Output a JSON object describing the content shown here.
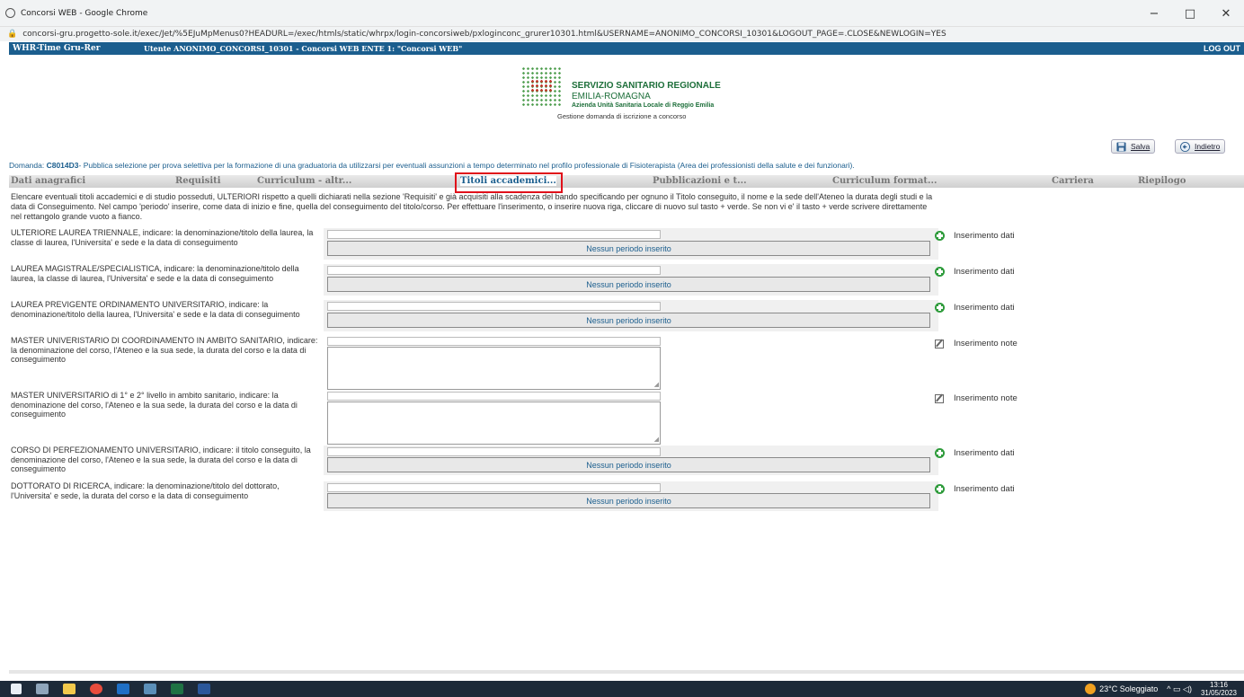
{
  "browser": {
    "window_title": "Concorsi WEB - Google Chrome",
    "url": "concorsi-gru.progetto-sole.it/exec/Jet/%5EJuMpMenus0?HEADURL=/exec/htmls/static/whrpx/login-concorsiweb/pxloginconc_grurer10301.html&USERNAME=ANONIMO_CONCORSI_10301&LOGOUT_PAGE=.CLOSE&NEWLOGIN=YES",
    "minimize": "−",
    "maximize": "□",
    "close": "✕"
  },
  "app_bar": {
    "brand": "WHR-Time Gru-Rer",
    "user": "Utente ANONIMO_CONCORSI_10301 - Concorsi WEB ENTE 1: \"Concorsi WEB\"",
    "logout": "LOG OUT"
  },
  "logo": {
    "line1": "SERVIZIO SANITARIO REGIONALE",
    "line2": "EMILIA-ROMAGNA",
    "line3": "Azienda Unità Sanitaria Locale di Reggio Emilia",
    "line4": "Gestione domanda di iscrizione a concorso"
  },
  "buttons": {
    "save": "Salva",
    "back": "Indietro"
  },
  "domanda": {
    "prefix": "Domanda: ",
    "code": "C8014D3",
    "text": "- Pubblica selezione per prova selettiva per la formazione di una graduatoria da utilizzarsi per eventuali assunzioni a tempo determinato nel profilo professionale di Fisioterapista (Area dei professionisti della salute e dei funzionari)."
  },
  "tabs": [
    {
      "label": "Dati anagrafici"
    },
    {
      "label": "Requisiti"
    },
    {
      "label": "Curriculum - altr..."
    },
    {
      "label": "Titoli accademici..."
    },
    {
      "label": "Pubblicazioni e t..."
    },
    {
      "label": "Curriculum format..."
    },
    {
      "label": "Carriera"
    },
    {
      "label": "Riepilogo"
    }
  ],
  "intro": "Elencare eventuali titoli accademici e di studio posseduti, ULTERIORI rispetto a quelli dichiarati nella sezione 'Requisiti' e già acquisiti alla scadenza del bando specificando per ognuno il Titolo conseguito, il nome e la sede dell'Ateneo la durata degli studi e la data di Conseguimento. Nel campo 'periodo' inserire, come data di inizio e fine, quella del conseguimento del titolo/corso. Per effettuare l'inserimento, o inserire nuova riga, cliccare di nuovo sul tasto + verde. Se non vi e' il tasto + verde scrivere direttamente nel rettangolo grande vuoto a fianco.",
  "rows": [
    {
      "label": "ULTERIORE LAUREA TRIENNALE, indicare: la denominazione/titolo della laurea, la classe di laurea, l'Universita' e sede e la data di conseguimento",
      "period": "Nessun periodo inserito",
      "action": "Inserimento dati"
    },
    {
      "label": "LAUREA MAGISTRALE/SPECIALISTICA, indicare: la denominazione/titolo della laurea, la classe di laurea, l'Universita' e sede e la data di conseguimento",
      "period": "Nessun periodo inserito",
      "action": "Inserimento dati"
    },
    {
      "label": "LAUREA PREVIGENTE ORDINAMENTO UNIVERSITARIO, indicare: la denominazione/titolo della laurea, l'Universita' e sede e la data di conseguimento",
      "period": "Nessun periodo inserito",
      "action": "Inserimento dati"
    },
    {
      "label": "MASTER UNIVERISTARIO DI COORDINAMENTO IN AMBITO SANITARIO, indicare: la denominazione del corso, l'Ateneo e la sua sede, la durata del corso e la data di conseguimento",
      "action": "Inserimento note"
    },
    {
      "label": "MASTER UNIVERSITARIO di 1° e 2° livello in ambito sanitario, indicare: la denominazione del corso, l'Ateneo e la sua sede, la durata del corso e la data di conseguimento",
      "action": "Inserimento note"
    },
    {
      "label": "CORSO DI PERFEZIONAMENTO UNIVERSITARIO, indicare: il titolo conseguito, la denominazione del corso, l'Ateneo e la sua sede, la durata del corso e la data di conseguimento",
      "period": "Nessun periodo inserito",
      "action": "Inserimento dati"
    },
    {
      "label": "DOTTORATO DI RICERCA, indicare: la denominazione/titolo del dottorato, l'Universita' e sede, la durata del corso e la data di conseguimento",
      "period": "Nessun periodo inserito",
      "action": "Inserimento dati"
    }
  ],
  "taskbar": {
    "weather": "23°C Soleggiato",
    "time": "13:16",
    "date": "31/05/2023"
  }
}
